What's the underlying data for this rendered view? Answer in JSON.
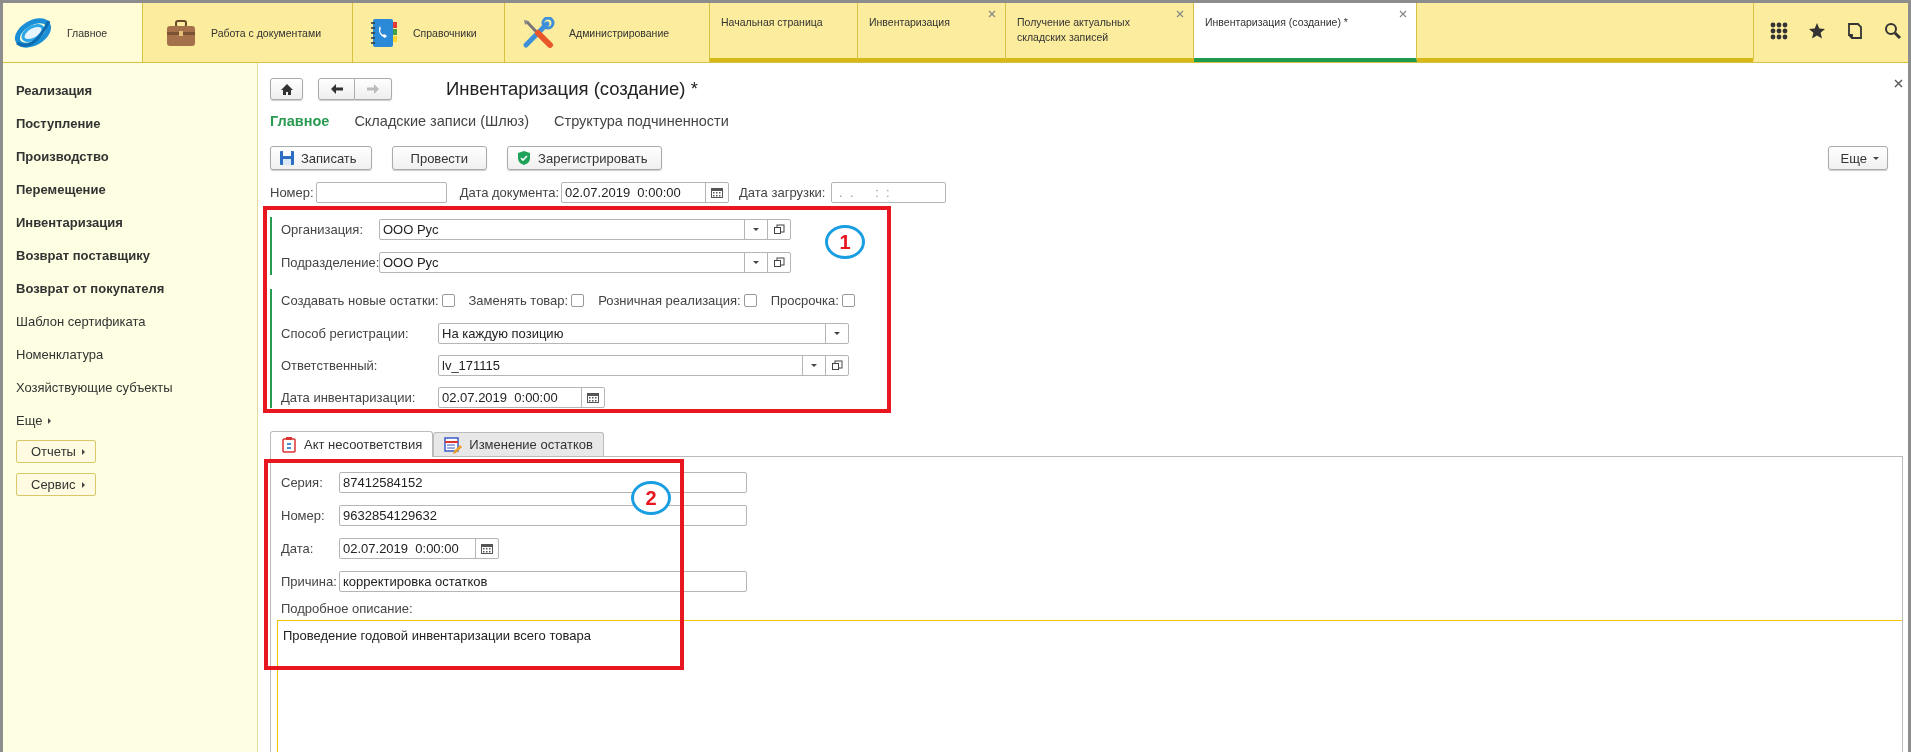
{
  "sections": [
    {
      "label": "Главное",
      "selected": true
    },
    {
      "label": "Работа с документами",
      "selected": false
    },
    {
      "label": "Справочники",
      "selected": false
    },
    {
      "label": "Администрирование",
      "selected": false
    }
  ],
  "open_tabs": [
    {
      "label": "Начальная страница",
      "selected": false,
      "closable": false
    },
    {
      "label": "Инвентаризация",
      "selected": false,
      "closable": true
    },
    {
      "label": "Получение актуальных складских записей",
      "selected": false,
      "closable": true
    },
    {
      "label": "Инвентаризация (создание) *",
      "selected": true,
      "closable": true
    }
  ],
  "sidebar": {
    "items": [
      {
        "label": "Реализация",
        "bold": true
      },
      {
        "label": "Поступление",
        "bold": true
      },
      {
        "label": "Производство",
        "bold": true
      },
      {
        "label": "Перемещение",
        "bold": true
      },
      {
        "label": "Инвентаризация",
        "bold": true
      },
      {
        "label": "Возврат поставщику",
        "bold": true
      },
      {
        "label": "Возврат от покупателя",
        "bold": true
      },
      {
        "label": "Шаблон сертификата",
        "bold": false
      },
      {
        "label": "Номенклатура",
        "bold": false
      },
      {
        "label": "Хозяйствующие субъекты",
        "bold": false
      }
    ],
    "more": "Еще",
    "buttons": [
      "Отчеты",
      "Сервис"
    ]
  },
  "form": {
    "title": "Инвентаризация (создание) *",
    "tabs": [
      {
        "label": "Главное",
        "selected": true
      },
      {
        "label": "Складские записи (Шлюз)",
        "selected": false
      },
      {
        "label": "Структура подчиненности",
        "selected": false
      }
    ],
    "commands": [
      "Записать",
      "Провести",
      "Зарегистрировать"
    ],
    "more": "Еще",
    "header_fields": [
      {
        "label": "Номер:",
        "kind": "text"
      },
      {
        "label": "Дата документа:",
        "value": "02.07.2019  0:00:00",
        "kind": "date"
      },
      {
        "label": "Дата загрузки:",
        "mask": " .  .      :  :",
        "kind": "text"
      }
    ],
    "group1": [
      {
        "label": "Организация:",
        "value": "ООО Рус"
      },
      {
        "label": "Подразделение:",
        "value": "ООО Рус"
      }
    ],
    "checkboxes": [
      {
        "label": "Создавать новые остатки:",
        "checked": false
      },
      {
        "label": "Заменять товар:",
        "checked": false
      },
      {
        "label": "Розничная реализация:",
        "checked": false
      },
      {
        "label": "Просрочка:",
        "checked": false
      }
    ],
    "group2": [
      {
        "label": "Способ регистрации:",
        "value": "На каждую позицию",
        "kind": "select"
      },
      {
        "label": "Ответственный:",
        "value": "lv_171115",
        "kind": "ref"
      },
      {
        "label": "Дата инвентаризации:",
        "value": "02.07.2019  0:00:00",
        "kind": "date"
      }
    ],
    "page_tabs": [
      {
        "label": "Акт несоответствия",
        "selected": true
      },
      {
        "label": "Изменение остатков",
        "selected": false
      }
    ],
    "act_fields": [
      {
        "label": "Серия:",
        "value": "87412584152",
        "kind": "text"
      },
      {
        "label": "Номер:",
        "value": "9632854129632",
        "kind": "text"
      },
      {
        "label": "Дата:",
        "value": "02.07.2019  0:00:00",
        "kind": "date"
      },
      {
        "label": "Причина:",
        "value": "корректировка остатков",
        "kind": "text"
      }
    ],
    "description": {
      "label": "Подробное описание:",
      "value": "Проведение годовой инвентаризации всего товара"
    }
  },
  "annotations": [
    {
      "number": "1"
    },
    {
      "number": "2"
    }
  ]
}
